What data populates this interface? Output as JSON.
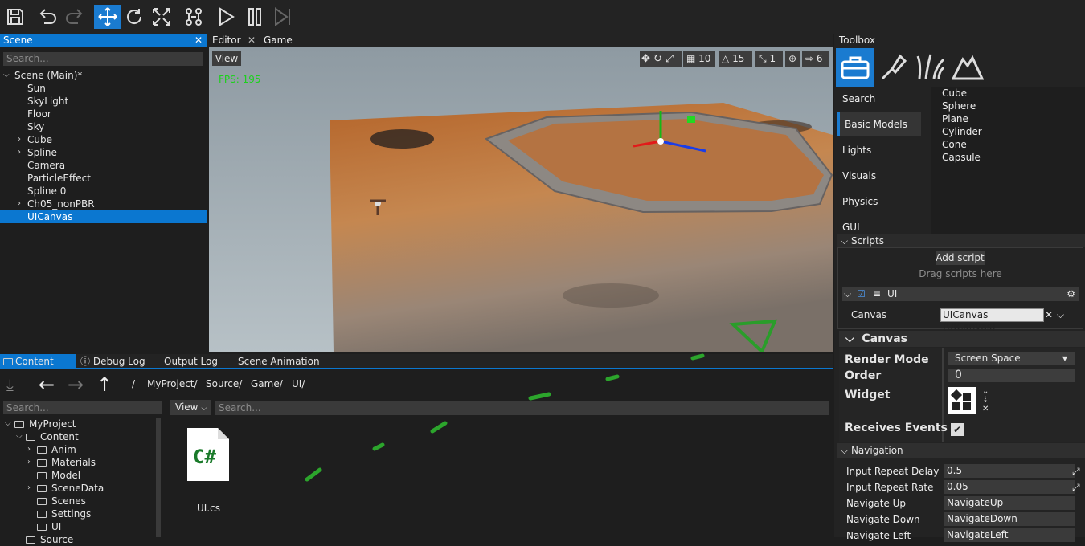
{
  "toolbar": {
    "icons": [
      "save-icon",
      "undo-icon",
      "redo-icon",
      "move-icon",
      "rotate-icon",
      "scale-icon",
      "bones-icon",
      "play-icon",
      "pause-icon",
      "step-icon"
    ]
  },
  "scene": {
    "title": "Scene",
    "search_placeholder": "Search...",
    "items": [
      {
        "label": "Scene (Main)*",
        "depth": 0,
        "expander": "open"
      },
      {
        "label": "Sun",
        "depth": 1
      },
      {
        "label": "SkyLight",
        "depth": 1
      },
      {
        "label": "Floor",
        "depth": 1
      },
      {
        "label": "Sky",
        "depth": 1
      },
      {
        "label": "Cube",
        "depth": 1,
        "expander": "closed"
      },
      {
        "label": "Spline",
        "depth": 1,
        "expander": "closed"
      },
      {
        "label": "Camera",
        "depth": 1
      },
      {
        "label": "ParticleEffect",
        "depth": 1
      },
      {
        "label": "Spline 0",
        "depth": 1
      },
      {
        "label": "Ch05_nonPBR",
        "depth": 1,
        "expander": "closed"
      },
      {
        "label": "UICanvas",
        "depth": 1,
        "selected": true
      }
    ]
  },
  "editor_tabs": {
    "editor": "Editor",
    "game": "Game"
  },
  "viewport": {
    "view_label": "View",
    "fps": "FPS: 195",
    "grid": "10",
    "angle": "15",
    "scale": "1",
    "speed": "6"
  },
  "toolbox": {
    "title": "Toolbox",
    "categories": [
      "Search",
      "Basic Models",
      "Lights",
      "Visuals",
      "Physics",
      "GUI"
    ],
    "selected": "Basic Models",
    "models": [
      "Cube",
      "Sphere",
      "Plane",
      "Cylinder",
      "Cone",
      "Capsule"
    ]
  },
  "scripts": {
    "header": "Scripts",
    "add_button": "Add script",
    "drag_hint": "Drag scripts here",
    "script_name": "UI",
    "canvas_label": "Canvas",
    "canvas_value": "UICanvas (UICanvas)"
  },
  "canvas": {
    "header": "Canvas",
    "render_mode_label": "Render Mode",
    "render_mode": "Screen Space",
    "order_label": "Order",
    "order": "0",
    "widget_label": "Widget",
    "receives_label": "Receives Events"
  },
  "navigation": {
    "header": "Navigation",
    "rows": [
      {
        "label": "Input Repeat Delay",
        "value": "0.5"
      },
      {
        "label": "Input Repeat Rate",
        "value": "0.05"
      },
      {
        "label": "Navigate Up",
        "value": "NavigateUp"
      },
      {
        "label": "Navigate Down",
        "value": "NavigateDown"
      },
      {
        "label": "Navigate Left",
        "value": "NavigateLeft"
      }
    ]
  },
  "content_tabs": [
    "Content",
    "Debug Log",
    "Output Log",
    "Scene Animation"
  ],
  "content": {
    "breadcrumb": [
      "/",
      "MyProject/",
      "Source/",
      "Game/",
      "UI/"
    ],
    "search_placeholder": "Search...",
    "view_label": "View",
    "file_name": "UI.cs",
    "file_badge": "C#",
    "tree": [
      {
        "label": "MyProject",
        "depth": 0,
        "expander": "open"
      },
      {
        "label": "Content",
        "depth": 1,
        "expander": "open"
      },
      {
        "label": "Anim",
        "depth": 2,
        "expander": "closed"
      },
      {
        "label": "Materials",
        "depth": 2,
        "expander": "closed"
      },
      {
        "label": "Model",
        "depth": 2
      },
      {
        "label": "SceneData",
        "depth": 2,
        "expander": "closed"
      },
      {
        "label": "Scenes",
        "depth": 2
      },
      {
        "label": "Settings",
        "depth": 2
      },
      {
        "label": "UI",
        "depth": 2
      },
      {
        "label": "Source",
        "depth": 1
      }
    ]
  }
}
